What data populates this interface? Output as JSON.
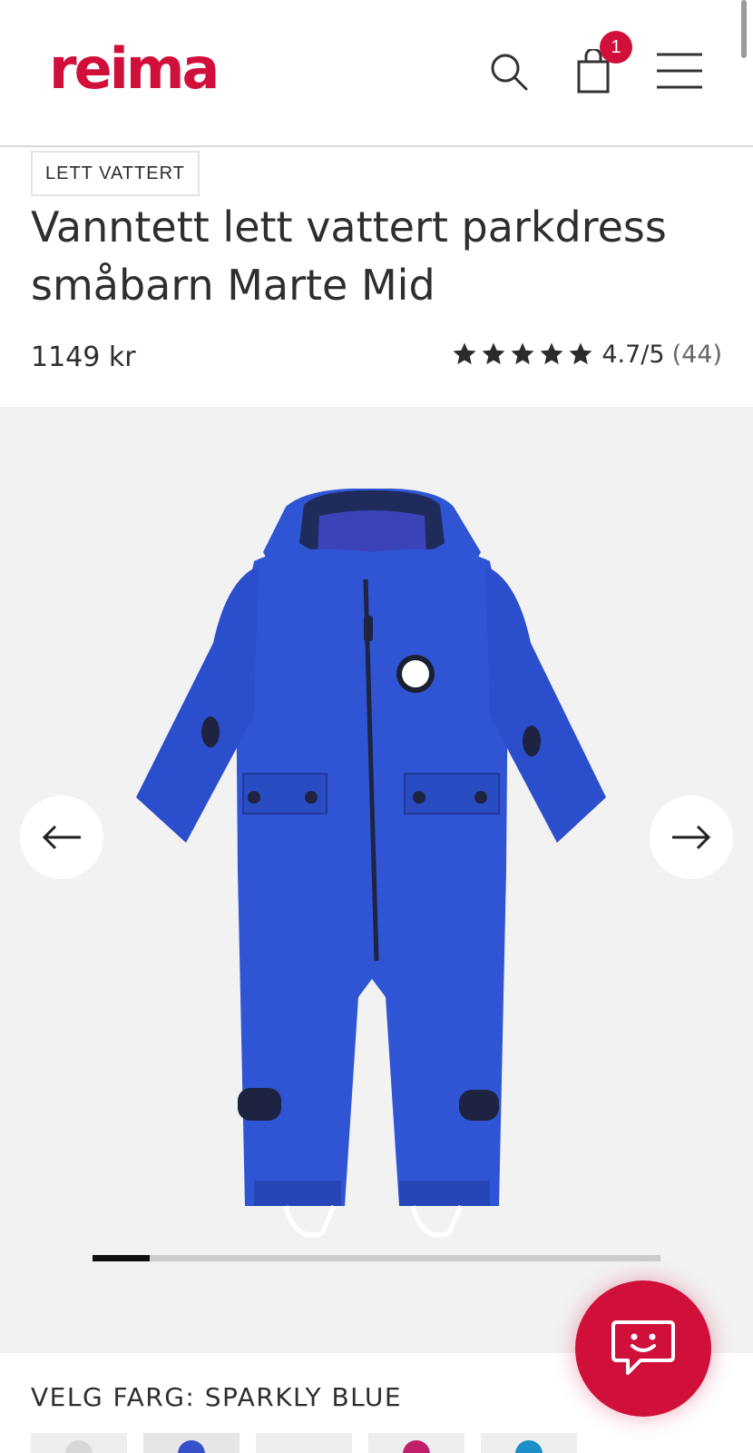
{
  "header": {
    "logo": "reima",
    "cart_count": "1",
    "icons": [
      "search-icon",
      "shopping-bag-icon",
      "hamburger-menu-icon"
    ]
  },
  "product": {
    "tag": "LETT VATTERT",
    "title": "Vanntett lett vattert parkdress småbarn Marte Mid",
    "price": "1149 kr",
    "rating": {
      "stars": 5,
      "score": "4.7/5",
      "count": "(44)"
    }
  },
  "gallery": {
    "image_alt": "Blue toddler snowsuit",
    "progress": 0.1,
    "icons": [
      "arrow-left-icon",
      "arrow-right-icon"
    ]
  },
  "color_picker": {
    "label": "VELG FARG: SPARKLY BLUE",
    "swatches": [
      {
        "name": "grey",
        "color": "#d8d8d8"
      },
      {
        "name": "sparkly blue",
        "color": "#3550c8"
      },
      {
        "name": "light",
        "color": "#eeeeee"
      },
      {
        "name": "magenta",
        "color": "#c01f6a"
      },
      {
        "name": "turquoise",
        "color": "#1d8fc8"
      }
    ]
  },
  "colors": {
    "brand": "#d0103a",
    "product_blue": "#2f55d4"
  },
  "chat": {
    "icon": "chat-smile-icon"
  }
}
